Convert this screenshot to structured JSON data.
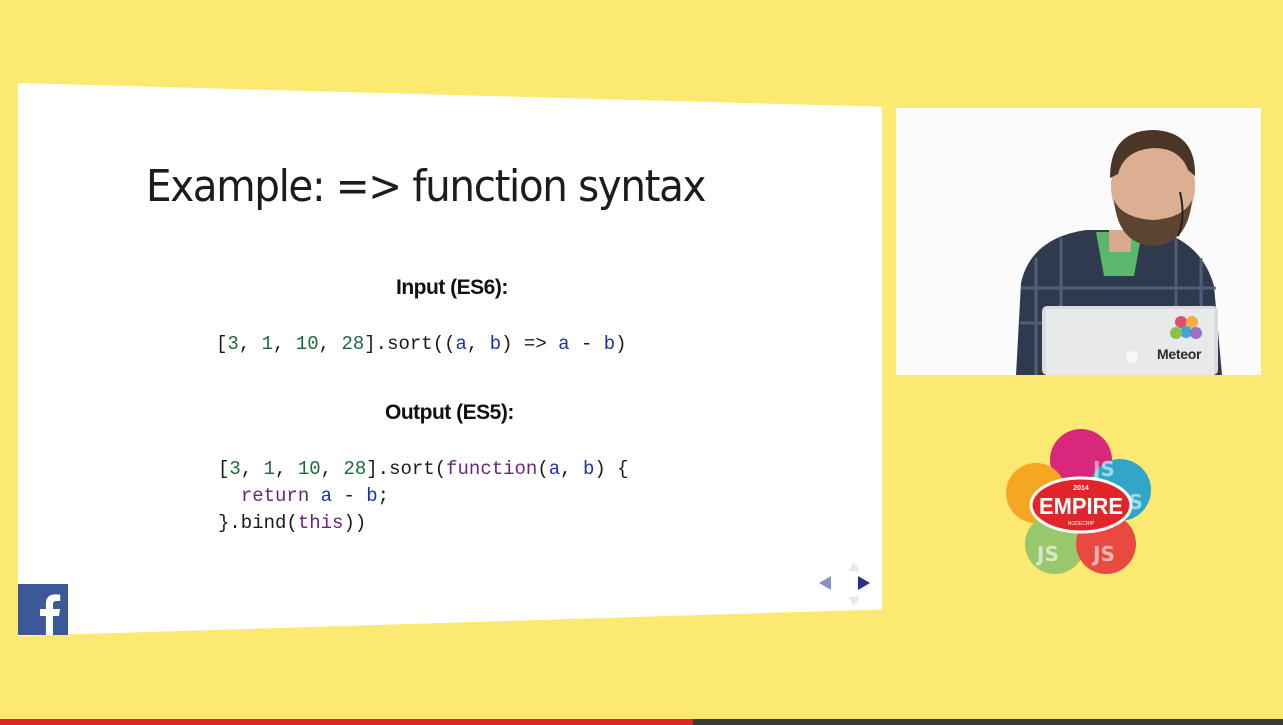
{
  "slide": {
    "title": "Example: => function syntax",
    "input_label": "Input (ES6):",
    "output_label": "Output (ES5):",
    "input_code": [
      {
        "t": "[",
        "c": "p"
      },
      {
        "t": "3",
        "c": "n"
      },
      {
        "t": ", ",
        "c": "p"
      },
      {
        "t": "1",
        "c": "n"
      },
      {
        "t": ", ",
        "c": "p"
      },
      {
        "t": "10",
        "c": "n"
      },
      {
        "t": ", ",
        "c": "p"
      },
      {
        "t": "28",
        "c": "n"
      },
      {
        "t": "].sort((",
        "c": "p"
      },
      {
        "t": "a",
        "c": "v"
      },
      {
        "t": ", ",
        "c": "p"
      },
      {
        "t": "b",
        "c": "v"
      },
      {
        "t": ") => ",
        "c": "p"
      },
      {
        "t": "a",
        "c": "v"
      },
      {
        "t": " - ",
        "c": "p"
      },
      {
        "t": "b",
        "c": "v"
      },
      {
        "t": ")",
        "c": "p"
      }
    ],
    "output_code": [
      {
        "t": "[",
        "c": "p"
      },
      {
        "t": "3",
        "c": "n"
      },
      {
        "t": ", ",
        "c": "p"
      },
      {
        "t": "1",
        "c": "n"
      },
      {
        "t": ", ",
        "c": "p"
      },
      {
        "t": "10",
        "c": "n"
      },
      {
        "t": ", ",
        "c": "p"
      },
      {
        "t": "28",
        "c": "n"
      },
      {
        "t": "].sort(",
        "c": "p"
      },
      {
        "t": "function",
        "c": "k"
      },
      {
        "t": "(",
        "c": "p"
      },
      {
        "t": "a",
        "c": "v"
      },
      {
        "t": ", ",
        "c": "p"
      },
      {
        "t": "b",
        "c": "v"
      },
      {
        "t": ") {\n  ",
        "c": "p"
      },
      {
        "t": "return",
        "c": "k"
      },
      {
        "t": " ",
        "c": "p"
      },
      {
        "t": "a",
        "c": "v"
      },
      {
        "t": " - ",
        "c": "p"
      },
      {
        "t": "b",
        "c": "v"
      },
      {
        "t": ";\n}.bind(",
        "c": "p"
      },
      {
        "t": "this",
        "c": "k"
      },
      {
        "t": "))",
        "c": "p"
      }
    ]
  },
  "video": {
    "laptop_brand": "Meteor"
  },
  "logo": {
    "year": "2014",
    "name": "EMPIRE",
    "subtitle": "NODECRIP",
    "petal_text": "JS"
  },
  "player": {
    "progress": 0.54
  },
  "colors": {
    "background": "#fbe971",
    "facebook": "#3b5998",
    "progress": "#e1252a",
    "empire_red": "#e1252a"
  },
  "icons": {
    "facebook": "facebook-icon",
    "nav_prev": "arrow-left-icon",
    "nav_next": "arrow-right-icon"
  }
}
